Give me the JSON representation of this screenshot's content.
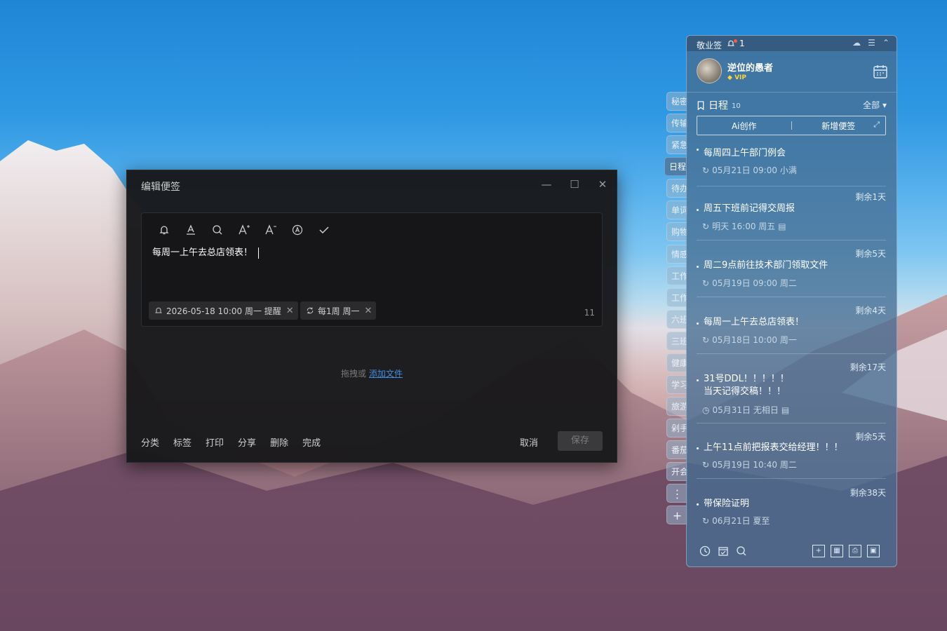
{
  "editor": {
    "title": "编辑便签",
    "note_text": "每周一上午去总店领表！",
    "reminder_chip": "2026-05-18 10:00 周一 提醒",
    "repeat_chip": "每1周 周一",
    "char_count": "11",
    "drop_hint": "拖拽或",
    "add_file_link": "添加文件",
    "actions": [
      "分类",
      "标签",
      "打印",
      "分享",
      "删除",
      "完成"
    ],
    "cancel_label": "取消",
    "save_label": "保存",
    "toolbar_icons": [
      "bell-icon",
      "text-color-icon",
      "search-icon",
      "font-increase-icon",
      "font-decrease-icon",
      "format-icon",
      "check-icon"
    ]
  },
  "side_tabs": [
    "秘密",
    "传输",
    "紧急",
    "日程",
    "待办",
    "单词",
    "购物",
    "情感",
    "工作",
    "工作",
    "六班",
    "三班",
    "健康",
    "学习",
    "旅游",
    "剁手",
    "番茄",
    "开会",
    "⋮",
    "+"
  ],
  "panel": {
    "app_name": "敬业签",
    "notification_count": "1",
    "user_name": "逆位的愚者",
    "vip_label": "VIP",
    "schedule_title": "日程",
    "schedule_count": "10",
    "filter_label": "全部",
    "ai_button": "Ai创作",
    "new_note_button": "新增便签",
    "items": [
      {
        "title": "每周四上午部门例会",
        "meta": "05月21日 09:00 小满",
        "tag": ""
      },
      {
        "title": "周五下班前记得交周报",
        "meta": "明天 16:00 周五",
        "tag": "剩余1天"
      },
      {
        "title": "周二9点前往技术部门领取文件",
        "meta": "05月19日 09:00 周二",
        "tag": "剩余5天"
      },
      {
        "title": "每周一上午去总店领表！",
        "meta": "05月18日 10:00 周一",
        "tag": "剩余4天"
      },
      {
        "title": "31号DDL！！！！！",
        "title2": "当天记得交稿！！！",
        "meta": "05月31日 无相日",
        "tag": "剩余17天"
      },
      {
        "title": "上午11点前把报表交给经理！！！",
        "meta": "05月19日 10:40 周二",
        "tag": "剩余5天"
      },
      {
        "title": "带保险证明",
        "meta": "06月21日 夏至",
        "tag": "剩余38天"
      }
    ]
  },
  "colors": {
    "accent_link": "#3f8fe3",
    "vip": "#ffd530",
    "notif_dot": "#ff5a3a"
  }
}
